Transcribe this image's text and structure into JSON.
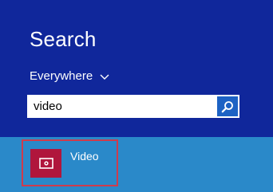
{
  "search_pane": {
    "title": "Search",
    "scope": {
      "label": "Everywhere",
      "icon": "chevron-down-icon"
    },
    "search": {
      "value": "video",
      "button_icon": "search-icon"
    },
    "results": [
      {
        "label": "Video",
        "icon": "video-app-icon",
        "tile_color": "#b0163c"
      }
    ]
  },
  "colors": {
    "background": "#10279b",
    "results_band": "#2a89c9",
    "search_button": "#1d62c4",
    "highlight": "#cf3b4c"
  }
}
